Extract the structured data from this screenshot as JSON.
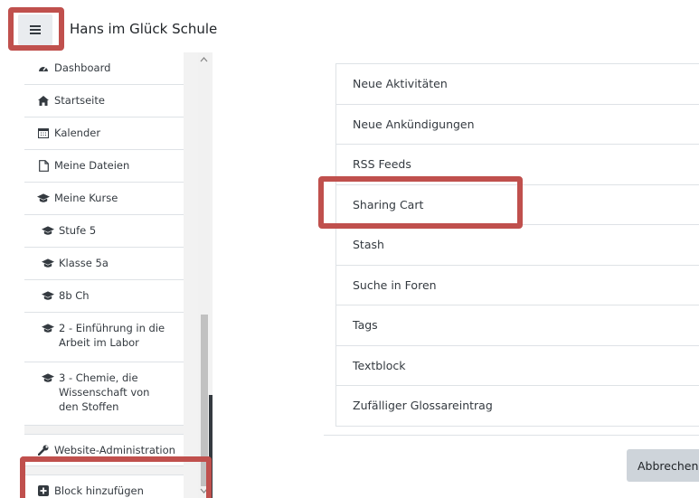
{
  "header": {
    "site_title": "Hans im Glück Schule",
    "menu_icon": "hamburger-icon"
  },
  "sidebar": {
    "items": [
      {
        "label": "Dashboard",
        "icon": "dashboard-icon"
      },
      {
        "label": "Startseite",
        "icon": "home-icon"
      },
      {
        "label": "Kalender",
        "icon": "calendar-icon"
      },
      {
        "label": "Meine Dateien",
        "icon": "file-icon"
      },
      {
        "label": "Meine Kurse",
        "icon": "graduation-cap-icon"
      },
      {
        "label": "Stufe 5",
        "icon": "graduation-cap-icon"
      },
      {
        "label": "Klasse 5a",
        "icon": "graduation-cap-icon"
      },
      {
        "label": "8b Ch",
        "icon": "graduation-cap-icon"
      },
      {
        "label": "2 - Einführung in die Arbeit im Labor",
        "icon": "graduation-cap-icon"
      },
      {
        "label": "3 - Chemie, die Wissenschaft von den Stoffen",
        "icon": "graduation-cap-icon"
      }
    ],
    "admin": {
      "label": "Website-Administration",
      "icon": "wrench-icon"
    },
    "add_block": {
      "label": "Block hinzufügen",
      "icon": "plus-square-icon"
    }
  },
  "blocks": {
    "items": [
      "Neue Aktivitäten",
      "Neue Ankündigungen",
      "RSS Feeds",
      "Sharing Cart",
      "Stash",
      "Suche in Foren",
      "Tags",
      "Textblock",
      "Zufälliger Glossareintrag"
    ],
    "cancel_label": "Abbrechen"
  },
  "colors": {
    "highlight": "#c0504d",
    "sidebar_bg": "#f2f2f2",
    "button_bg": "#ced4da"
  }
}
